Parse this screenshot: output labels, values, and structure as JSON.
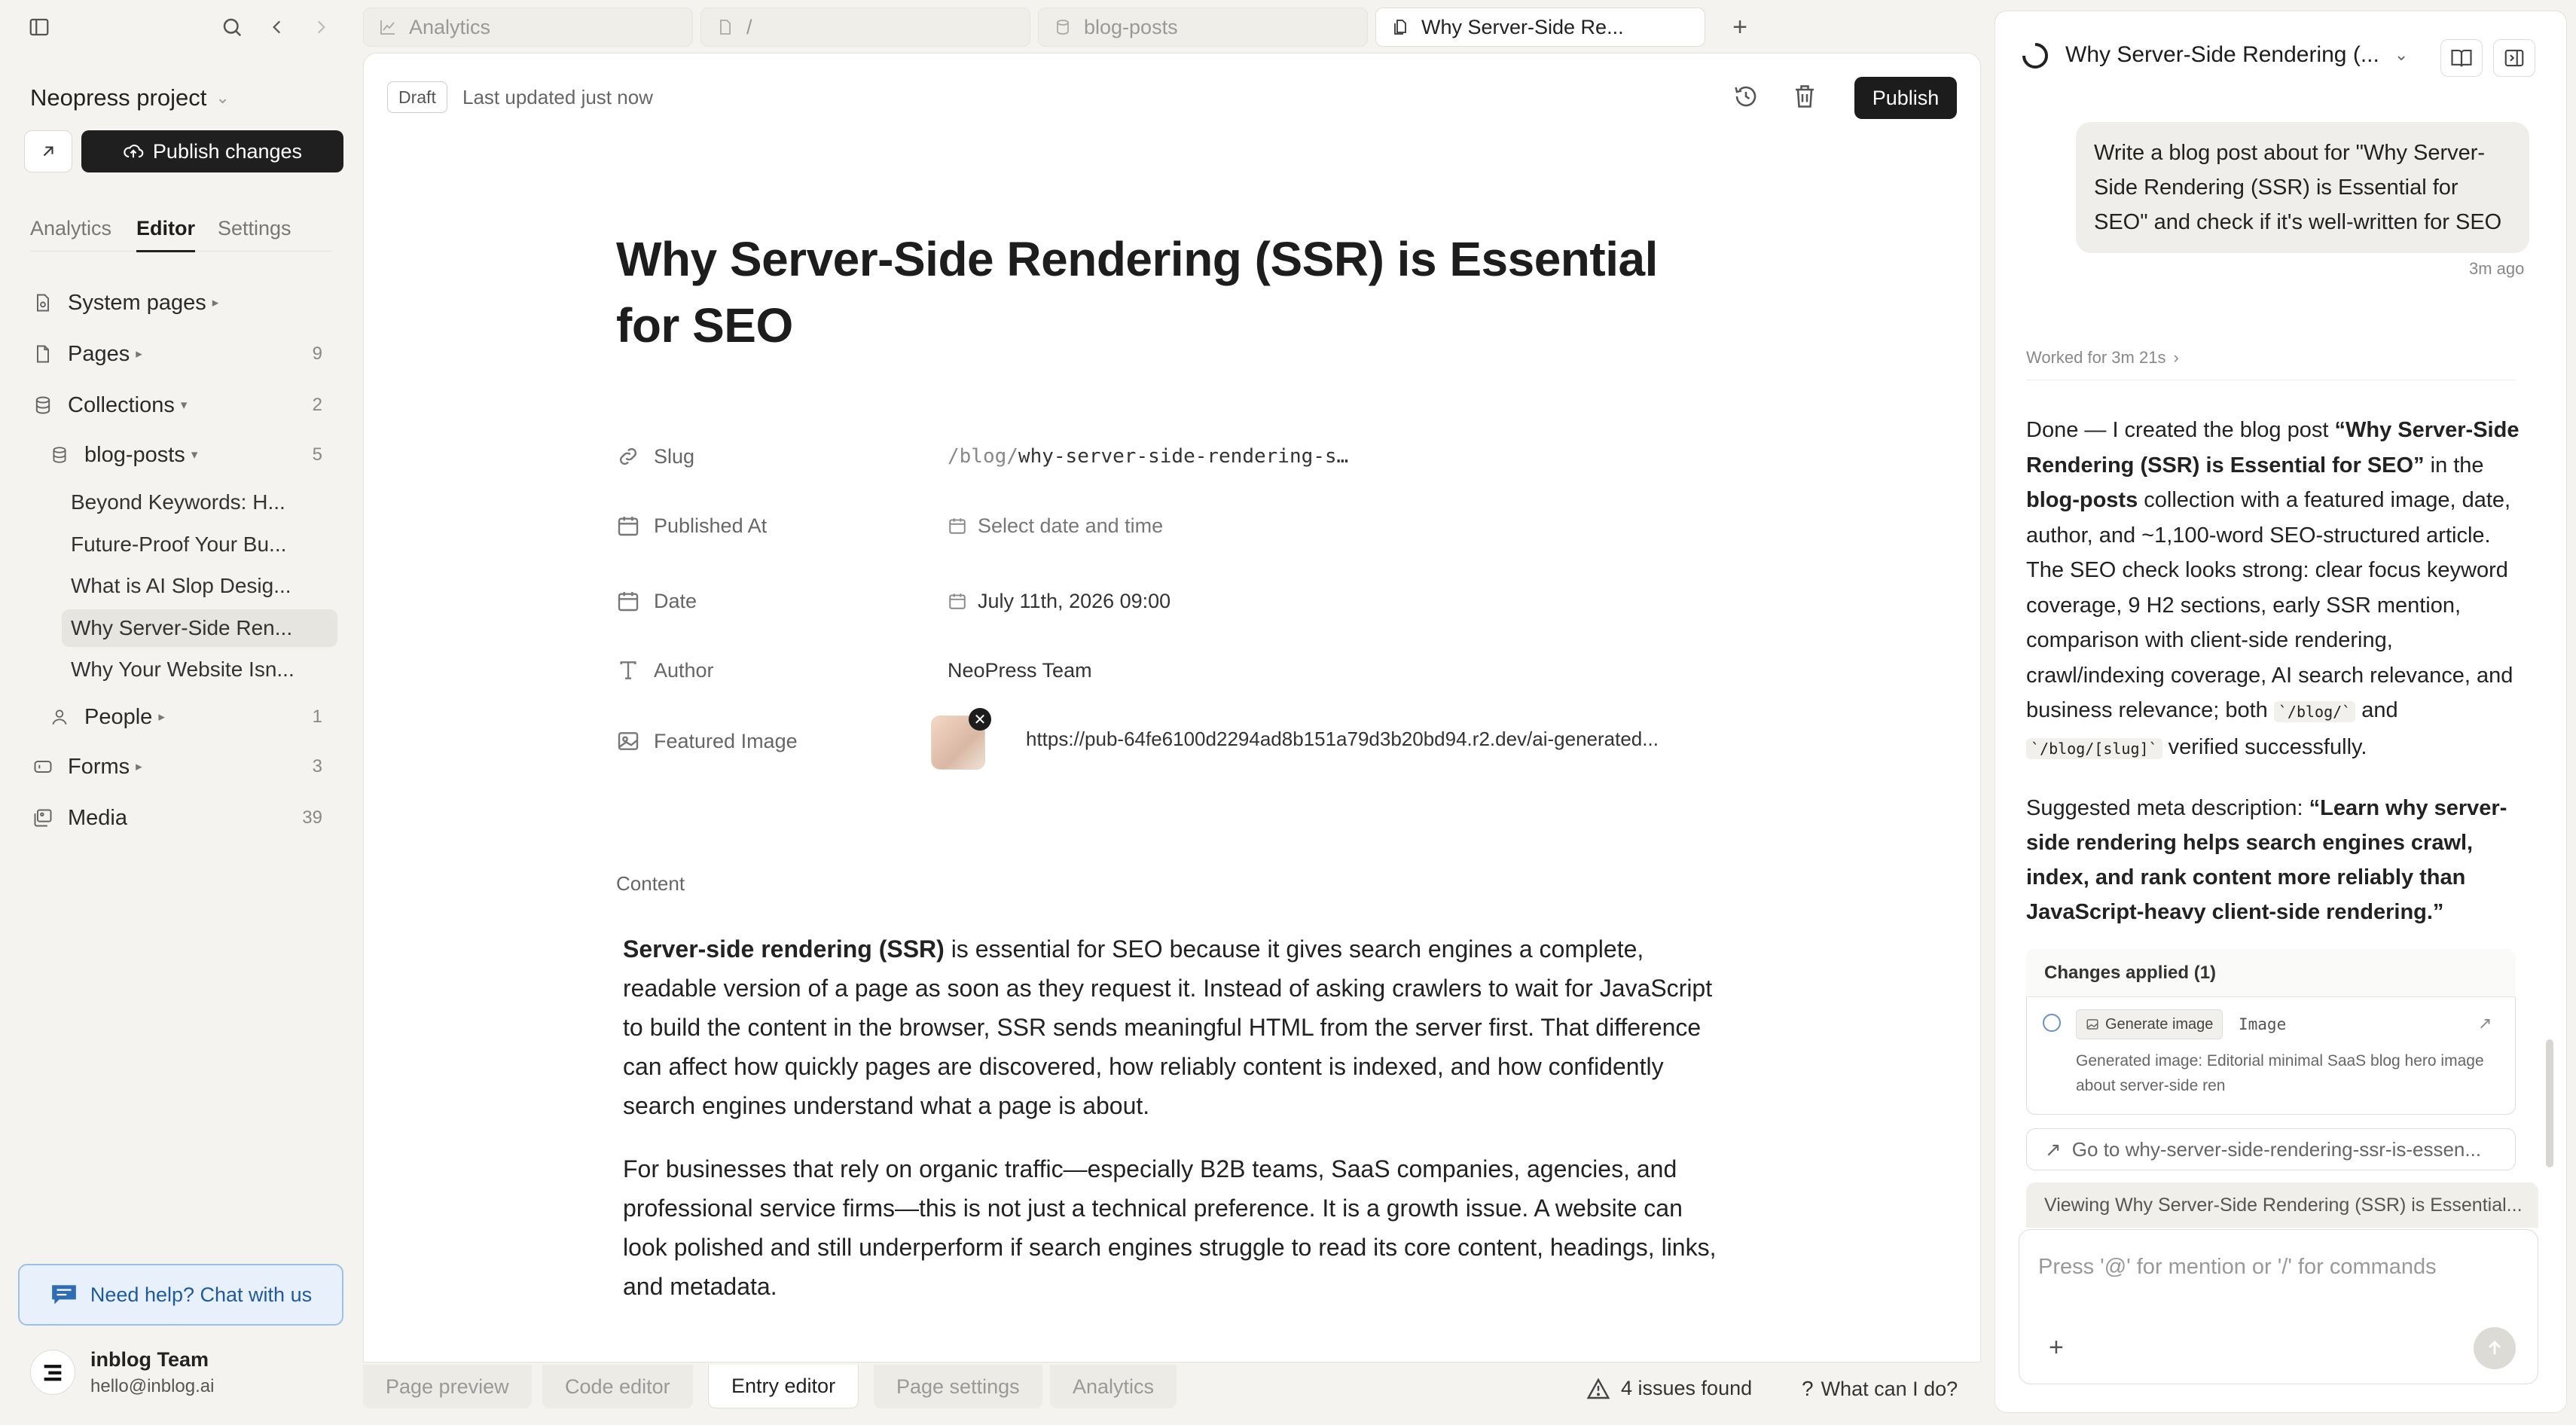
{
  "sidebar": {
    "project_name": "Neopress project",
    "publish_changes": "Publish changes",
    "tabs": [
      "Analytics",
      "Editor",
      "Settings"
    ],
    "tree": {
      "system_pages": "System pages",
      "pages": "Pages",
      "pages_count": "9",
      "collections": "Collections",
      "collections_count": "2",
      "blog_posts": "blog-posts",
      "blog_posts_count": "5",
      "children": [
        "Beyond Keywords: H...",
        "Future-Proof Your Bu...",
        "What is AI Slop Desig...",
        "Why Server-Side Ren...",
        "Why Your Website Isn..."
      ],
      "people": "People",
      "people_count": "1",
      "forms": "Forms",
      "forms_count": "3",
      "media": "Media",
      "media_count": "39"
    },
    "help": "Need help? Chat with us",
    "team_name": "inblog Team",
    "team_email": "hello@inblog.ai"
  },
  "tabs": {
    "t1": "Analytics",
    "t2": "/",
    "t3": "blog-posts",
    "t4": "Why Server-Side Re..."
  },
  "editor": {
    "status": "Draft",
    "last_updated": "Last updated just now",
    "publish": "Publish",
    "title": "Why Server-Side Rendering (SSR) is Essential for SEO",
    "fields": {
      "slug_label": "Slug",
      "slug_prefix": "/blog/",
      "slug_value": "why-server-side-rendering-s…",
      "published_label": "Published At",
      "published_placeholder": "Select date and time",
      "date_label": "Date",
      "date_value": "July 11th, 2026 09:00",
      "author_label": "Author",
      "author_value": "NeoPress Team",
      "image_label": "Featured Image",
      "image_url": "https://pub-64fe6100d2294ad8b151a79d3b20bd94.r2.dev/ai-generated..."
    },
    "content_label": "Content",
    "p1_bold": "Server-side rendering (SSR)",
    "p1_rest": " is essential for SEO because it gives search engines a complete, readable version of a page as soon as they request it. Instead of asking crawlers to wait for JavaScript to build the content in the browser, SSR sends meaningful HTML from the server first. That difference can affect how quickly pages are discovered, how reliably content is indexed, and how confidently search engines understand what a page is about.",
    "p2": "For businesses that rely on organic traffic—especially B2B teams, SaaS companies, agencies, and professional service firms—this is not just a technical preference. It is a growth issue. A website can look polished and still underperform if search engines struggle to read its core content, headings, links, and metadata."
  },
  "bottom_tabs": [
    "Page preview",
    "Code editor",
    "Entry editor",
    "Page settings",
    "Analytics"
  ],
  "issues": "4 issues found",
  "what_can": "What can I do?",
  "chat": {
    "title": "Why Server-Side Rendering (...",
    "user_msg": "Write a blog post about for \"Why Server-Side Rendering (SSR) is Essential for SEO\" and check if it's well-written for SEO",
    "user_time": "3m ago",
    "worked_for": "Worked for 3m 21s",
    "r_a": "Done — I created the blog post ",
    "r_b": "“Why Server-Side Rendering (SSR) is Essential for SEO”",
    "r_c": " in the ",
    "r_d": "blog-posts",
    "r_e": " collection with a featured image, date, author, and ~1,100-word SEO-structured article. The SEO check looks strong: clear focus keyword coverage, 9 H2 sections, early SSR mention, comparison with client-side rendering, crawl/indexing coverage, AI search relevance, and business relevance; both ",
    "r_code1": "`/blog/`",
    "r_f": " and ",
    "r_code2": "`/blog/[slug]`",
    "r_g": " verified successfully.",
    "meta_a": "Suggested meta description: ",
    "meta_b": "“Learn why server-side rendering helps search engines crawl, index, and rank content more reliably than JavaScript-heavy client-side rendering.”",
    "changes_head": "Changes applied (1)",
    "gen_image": "Generate image",
    "change_type": "Image",
    "change_desc": "Generated image: Editorial minimal SaaS blog hero image about server-side ren",
    "goto": "Go to why-server-side-rendering-ssr-is-essen...",
    "viewing": "Viewing Why Server-Side Rendering (SSR) is Essential...",
    "placeholder": "Press '@' for mention or '/' for commands"
  }
}
